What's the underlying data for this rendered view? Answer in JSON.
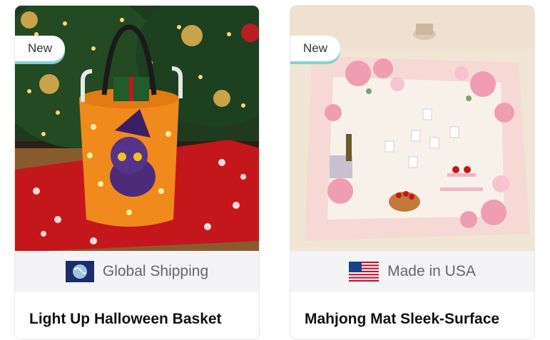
{
  "products": [
    {
      "badge": "New",
      "shipping_label": "Global Shipping",
      "shipping_icon": "globe-icon",
      "title": "Light Up Halloween Basket",
      "image_alt": "Orange light-up basket with purple witch cat, filled with gifts and candy canes, on red snowflake table runner in front of a Christmas tree"
    },
    {
      "badge": "New",
      "shipping_label": "Made in USA",
      "shipping_icon": "usa-flag-icon",
      "title": "Mahjong Mat Sleek-Surface",
      "image_alt": "Pink floral mahjong mat with tiles, champagne, cake stand and fruit basket on a table"
    }
  ],
  "colors": {
    "badge_underline": "#7fd3d0",
    "shipping_bg": "#f4f4f6",
    "card_border": "#e6e6e6"
  }
}
